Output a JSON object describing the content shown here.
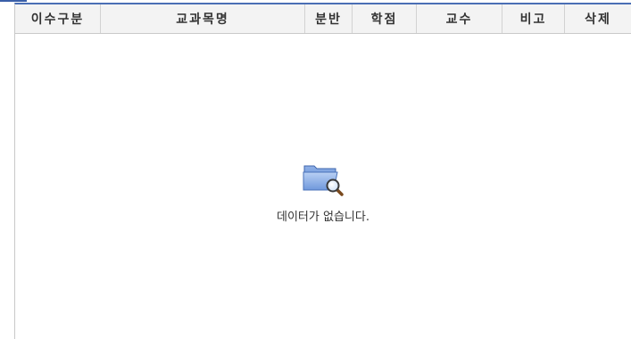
{
  "table": {
    "columns": [
      {
        "key": "course_type",
        "label": "이수구분"
      },
      {
        "key": "course_name",
        "label": "교과목명"
      },
      {
        "key": "section",
        "label": "분반"
      },
      {
        "key": "credits",
        "label": "학점"
      },
      {
        "key": "professor",
        "label": "교수"
      },
      {
        "key": "remarks",
        "label": "비고"
      },
      {
        "key": "delete",
        "label": "삭제"
      }
    ],
    "rows": [],
    "empty_message": "데이터가 없습니다.",
    "empty_icon": "folder-search-icon"
  },
  "colors": {
    "header_accent": "#4a6fb5",
    "header_bg": "#f3f3f3",
    "border": "#c9c9c9",
    "text": "#333333"
  }
}
